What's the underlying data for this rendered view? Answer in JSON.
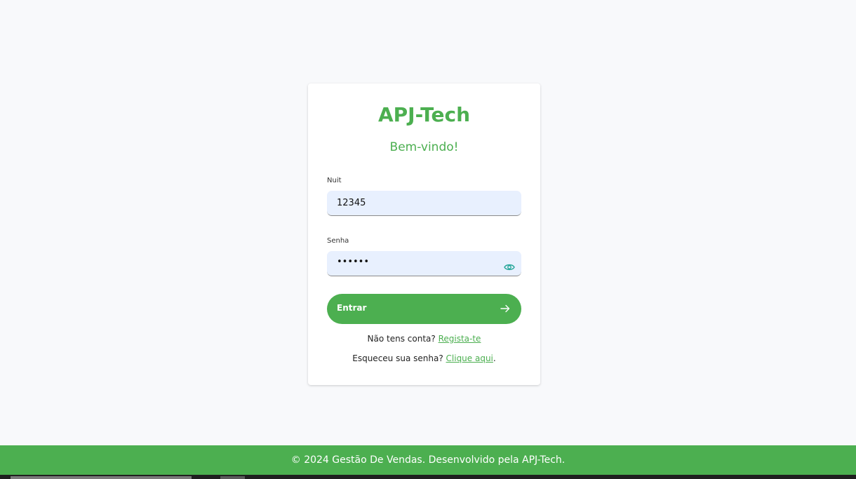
{
  "brand": {
    "title": "APJ-Tech",
    "welcome": "Bem-vindo!"
  },
  "form": {
    "nuit_label": "Nuit",
    "nuit_value": "12345",
    "senha_label": "Senha",
    "senha_value": "••••••",
    "submit_label": "Entrar"
  },
  "links": {
    "no_account": "Não tens conta?",
    "register": "Regista-te",
    "forgot": "Esqueceu sua senha?",
    "click_here": "Clique aqui",
    "period": "."
  },
  "footer": {
    "text": "© 2024 Gestão De Vendas. Desenvolvido pela APJ-Tech."
  },
  "colors": {
    "accent": "#4caf50",
    "input_bg": "#e8f0fe",
    "eye_icon": "#26a69a"
  },
  "icons": {
    "password_toggle": "eye-icon",
    "submit": "arrow-right-icon"
  }
}
